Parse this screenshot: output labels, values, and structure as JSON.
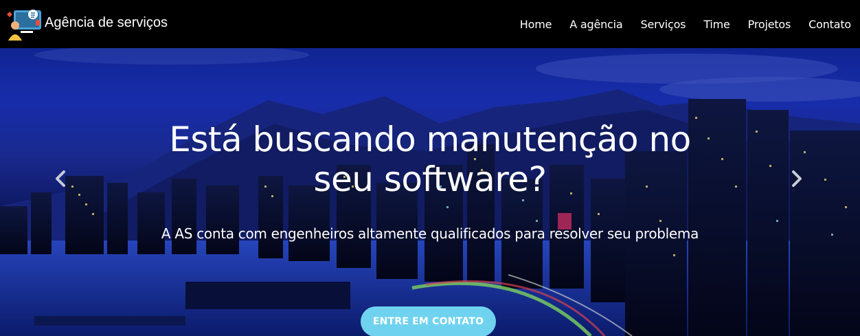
{
  "navbar": {
    "brand": "Agência de serviços",
    "logo_icon": "service-agency-logo-icon",
    "links": [
      {
        "label": "Home"
      },
      {
        "label": "A agência"
      },
      {
        "label": "Serviços"
      },
      {
        "label": "Time"
      },
      {
        "label": "Projetos"
      },
      {
        "label": "Contato"
      }
    ]
  },
  "hero": {
    "headline": "Está buscando manutenção no seu software?",
    "subheadline": "A AS conta com engenheiros altamente qualificados para resolver seu problema",
    "cta_label": "Entre em contato",
    "prev_icon": "chevron-left-icon",
    "next_icon": "chevron-right-icon",
    "background": "night-city-skyline"
  },
  "colors": {
    "navbar_bg": "#000000",
    "cta_bg": "#6fd3f0",
    "text": "#ffffff",
    "sky": "#1b33c2"
  }
}
